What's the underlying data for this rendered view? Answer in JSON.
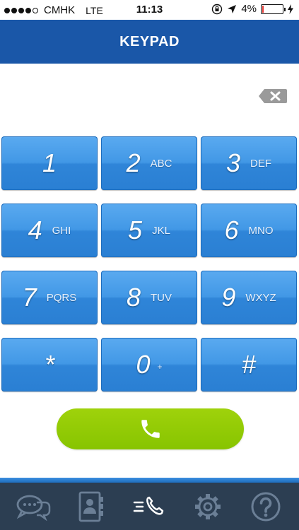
{
  "status_bar": {
    "carrier": "CMHK",
    "network": "LTE",
    "time": "11:13",
    "battery_text": "4%",
    "battery_level": 0.04,
    "signal_bars_filled": 4,
    "signal_bars_total": 5,
    "icons": [
      "rotation-lock-icon",
      "location-arrow-icon",
      "battery-icon",
      "charging-bolt-icon"
    ]
  },
  "header": {
    "title": "KEYPAD"
  },
  "display": {
    "number": "",
    "icon": "backspace-icon"
  },
  "keypad": {
    "keys": [
      {
        "digit": "1",
        "letters": ""
      },
      {
        "digit": "2",
        "letters": "ABC"
      },
      {
        "digit": "3",
        "letters": "DEF"
      },
      {
        "digit": "4",
        "letters": "GHI"
      },
      {
        "digit": "5",
        "letters": "JKL"
      },
      {
        "digit": "6",
        "letters": "MNO"
      },
      {
        "digit": "7",
        "letters": "PQRS"
      },
      {
        "digit": "8",
        "letters": "TUV"
      },
      {
        "digit": "9",
        "letters": "WXYZ"
      },
      {
        "digit": "*",
        "letters": ""
      },
      {
        "digit": "0",
        "letters": "+"
      },
      {
        "digit": "#",
        "letters": ""
      }
    ]
  },
  "call_button": {
    "icon": "phone-icon",
    "color": "#8cc800"
  },
  "tab_bar": {
    "tabs": [
      {
        "name": "chat",
        "icon": "chat-bubbles-icon",
        "active": false
      },
      {
        "name": "contacts",
        "icon": "contacts-book-icon",
        "active": false
      },
      {
        "name": "keypad",
        "icon": "phone-dial-icon",
        "active": true
      },
      {
        "name": "settings",
        "icon": "gear-icon",
        "active": false
      },
      {
        "name": "help",
        "icon": "help-icon",
        "active": false
      }
    ]
  },
  "colors": {
    "header": "#1a57a8",
    "key_blue": "#3b91e2",
    "call_green": "#8cc800",
    "tab_bar": "#2c3e52",
    "tab_icon_inactive": "#6b7f96",
    "tab_icon_active": "#ffffff"
  }
}
